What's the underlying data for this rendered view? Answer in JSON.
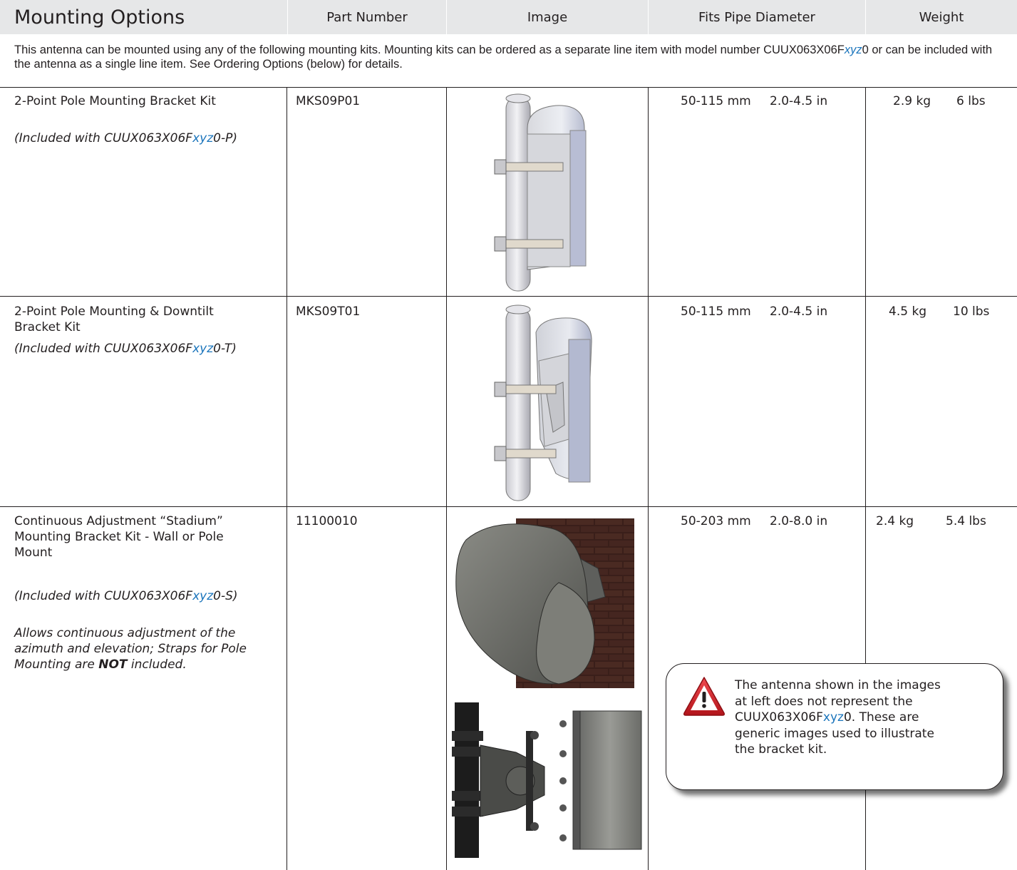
{
  "header": {
    "title": "Mounting Options",
    "columns": [
      "Part Number",
      "Image",
      "Fits Pipe Diameter",
      "Weight"
    ]
  },
  "intro": {
    "part1": "This antenna can be mounted using any of the following mounting kits. Mounting kits can be ordered as a separate line item with model number CUUX063X06F",
    "code": "xyz",
    "part2": "0 or can be included with the antenna as a single line item. See Ordering Options (below) for details."
  },
  "rows": [
    {
      "name": "2-Point Pole Mounting Bracket Kit",
      "included_pre": "(Included with CUUX063X06F",
      "included_code": "xyz",
      "included_post": "0-P)",
      "part_number": "MKS09P01",
      "pipe_mm": "50-115 mm",
      "pipe_in": "2.0-4.5 in",
      "weight_kg": "2.9 kg",
      "weight_lbs": "6 lbs"
    },
    {
      "name_line1": "2-Point Pole Mounting & Downtilt",
      "name_line2": "Bracket Kit",
      "included_pre": "(Included with CUUX063X06F",
      "included_code": "xyz",
      "included_post": "0-T)",
      "part_number": "MKS09T01",
      "pipe_mm": "50-115 mm",
      "pipe_in": "2.0-4.5 in",
      "weight_kg": "4.5 kg",
      "weight_lbs": "10 lbs"
    },
    {
      "name_line1": "Continuous Adjustment “Stadium”",
      "name_line2": "Mounting Bracket Kit - Wall or Pole",
      "name_line3": "Mount",
      "included_pre": "(Included with CUUX063X06F",
      "included_code": "xyz",
      "included_post": "0-S)",
      "note_line1": "Allows continuous adjustment of the",
      "note_line2": "azimuth and elevation; Straps for Pole",
      "note_line3_pre": "Mounting are ",
      "note_line3_bold": "NOT",
      "note_line3_post": " included.",
      "part_number": "11100010",
      "pipe_mm": "50-203 mm",
      "pipe_in": "2.0-8.0 in",
      "weight_kg": "2.4 kg",
      "weight_lbs": "5.4 lbs"
    }
  ],
  "callout": {
    "line1": "The antenna shown in the images",
    "line2": "at left does not represent the",
    "line3_pre": "CUUX063X06F",
    "line3_code": "xyz",
    "line3_post": "0.  These are",
    "line4": "generic images used to illustrate",
    "line5": "the bracket kit.",
    "icon": "warning-triangle-icon"
  },
  "colors": {
    "header_bg": "#e6e7e8",
    "text": "#231f20",
    "accent_blue": "#1b75bc",
    "warning_red": "#d2232a"
  }
}
